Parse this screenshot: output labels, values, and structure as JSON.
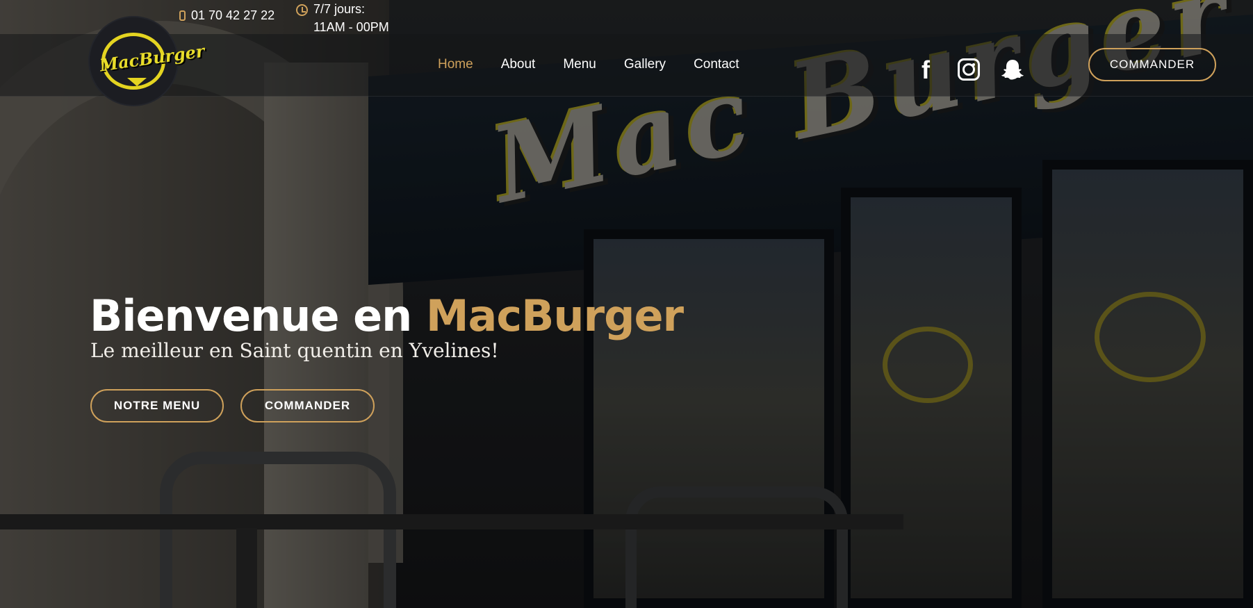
{
  "topbar": {
    "phone": "01 70 42 27 22",
    "hours_line1": "7/7 jours:",
    "hours_line2": "11AM - 00PM"
  },
  "logo": {
    "text": "MacBurger"
  },
  "nav": {
    "items": [
      {
        "label": "Home",
        "active": true
      },
      {
        "label": "About"
      },
      {
        "label": "Menu"
      },
      {
        "label": "Gallery"
      },
      {
        "label": "Contact"
      }
    ]
  },
  "social": {
    "facebook": "f",
    "icons": [
      "facebook-icon",
      "instagram-icon",
      "snapchat-icon"
    ]
  },
  "header_cta": "COMMANDER",
  "hero": {
    "title_prefix": "Bienvenue en ",
    "title_accent": "MacBurger",
    "subtitle": "Le meilleur en Saint quentin en Yvelines!",
    "btn_menu": "NOTRE MENU",
    "btn_order": "COMMANDER"
  },
  "background_sign": "Mac Burger",
  "colors": {
    "accent": "#cfa15b",
    "logo_yellow": "#e4d421",
    "text": "#ffffff"
  }
}
